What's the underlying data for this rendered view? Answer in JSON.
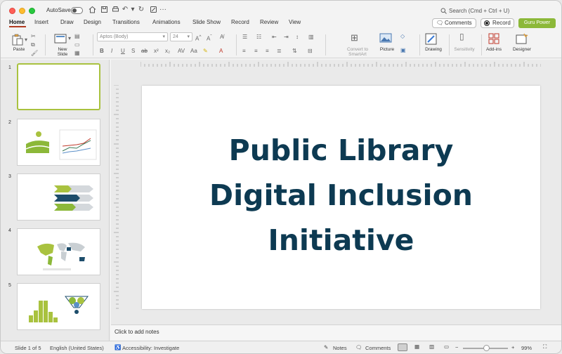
{
  "titlebar": {
    "autosave_label": "AutoSave",
    "search_placeholder": "Search (Cmd + Ctrl + U)"
  },
  "tabs": [
    "Home",
    "Insert",
    "Draw",
    "Design",
    "Transitions",
    "Animations",
    "Slide Show",
    "Record",
    "Review",
    "View"
  ],
  "top_right": {
    "comments_label": "Comments",
    "record_label": "Record",
    "guru_label": "Guru Power"
  },
  "ribbon": {
    "paste": "Paste",
    "new_slide": "New\nSlide",
    "font_name": "Aptos (Body)",
    "font_size": "24",
    "convert": "Convert to\nSmartArt",
    "picture": "Picture",
    "drawing": "Drawing",
    "sensitivity": "Sensitivity",
    "addins": "Add-ins",
    "designer": "Designer"
  },
  "slides": {
    "numbers": [
      "1",
      "2",
      "3",
      "4",
      "5"
    ],
    "current_title_lines": [
      "Public Library",
      "Digital Inclusion",
      "Initiative"
    ]
  },
  "notes": {
    "placeholder": "Click to add notes"
  },
  "status": {
    "slide_info": "Slide 1 of 5",
    "language": "English (United States)",
    "accessibility": "Accessibility: Investigate",
    "notes": "Notes",
    "comments": "Comments",
    "zoom": "99%"
  },
  "colors": {
    "accent_tab": "#b13a1f",
    "guru_button": "#8cb839",
    "title_text": "#0d3a52",
    "selected_thumb": "#a9c23f"
  }
}
